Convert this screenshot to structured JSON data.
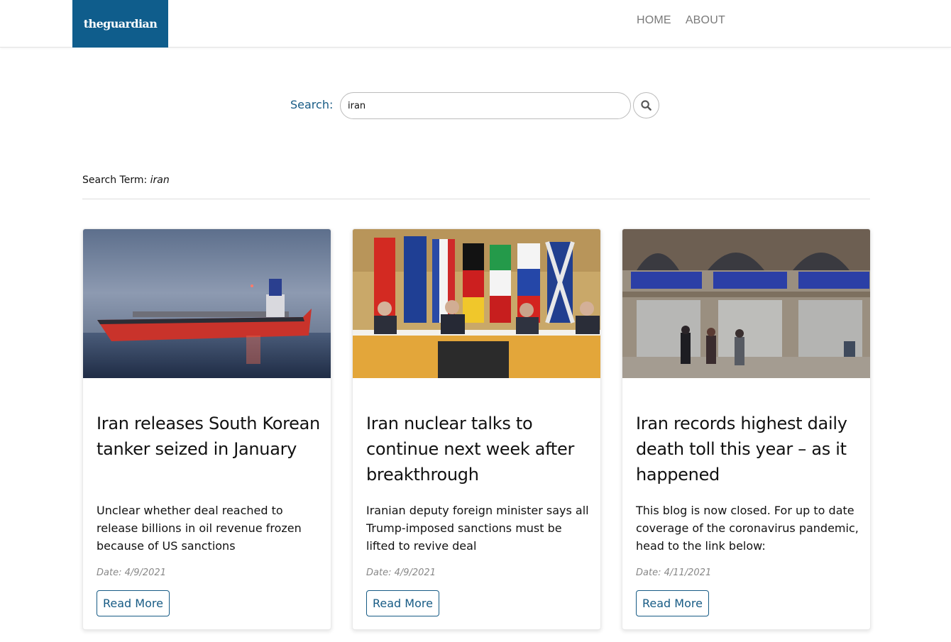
{
  "header": {
    "logo_text": "theguardian",
    "nav": [
      {
        "label": "HOME"
      },
      {
        "label": "ABOUT"
      }
    ]
  },
  "search": {
    "label": "Search:",
    "value": "iran",
    "button_icon": "search-icon"
  },
  "results": {
    "term_label": "Search Term:",
    "term_value": "iran"
  },
  "articles": [
    {
      "image": "tanker-ship-photo",
      "title": "Iran releases South Korean tanker seized in January",
      "description": "Unclear whether deal reached to release billions in oil revenue frozen because of US sanctions",
      "date": "Date: 4/9/2021",
      "button": "Read More"
    },
    {
      "image": "nuclear-talks-flags-photo",
      "title": "Iran nuclear talks to continue next week after breakthrough",
      "description": "Iranian deputy foreign minister says all Trump-imposed sanctions must be lifted to revive deal",
      "date": "Date: 4/9/2021",
      "button": "Read More"
    },
    {
      "image": "tehran-street-photo",
      "title": "Iran records highest daily death toll this year – as it happened",
      "description": "This blog is now closed. For up to date coverage of the coronavirus pandemic, head to the link below:",
      "date": "Date: 4/11/2021",
      "button": "Read More"
    }
  ],
  "colors": {
    "brand": "#0f5d8c",
    "link": "#175b85"
  }
}
